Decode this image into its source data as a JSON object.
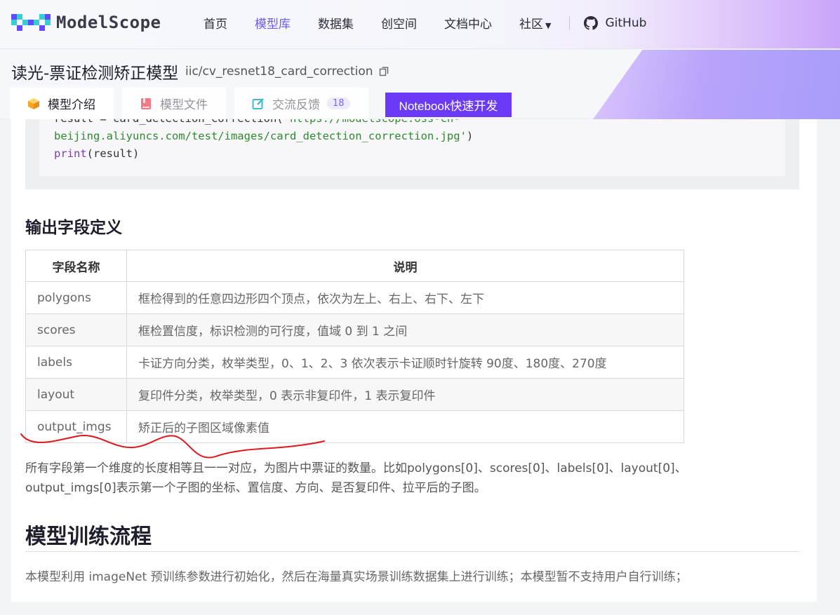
{
  "nav": {
    "logo_text": "ModelScope",
    "links": [
      {
        "label": "首页",
        "active": false
      },
      {
        "label": "模型库",
        "active": true
      },
      {
        "label": "数据集",
        "active": false
      },
      {
        "label": "创空间",
        "active": false
      },
      {
        "label": "文档中心",
        "active": false
      },
      {
        "label": "社区",
        "active": false
      }
    ],
    "github_label": "GitHub"
  },
  "model": {
    "title": "读光-票证检测矫正模型",
    "path": "iic/cv_resnet18_card_correction",
    "tabs": [
      {
        "label": "模型介绍",
        "icon": "box-icon"
      },
      {
        "label": "模型文件",
        "icon": "book-icon"
      },
      {
        "label": "交流反馈",
        "icon": "edit-icon",
        "count": "18"
      }
    ],
    "notebook_label": "Notebook快速开发"
  },
  "code": {
    "line1_a": "result = card_detection_correction(",
    "line1_b": "'https://modelscope.oss-cn-",
    "line2_a": "beijing.aliyuncs.com/test/images/card_detection_correction.jpg'",
    "line2_b": ")",
    "line3_fn": "print",
    "line3_rest": "(result)"
  },
  "output_section": {
    "title": "输出字段定义",
    "headers": [
      "字段名称",
      "说明"
    ],
    "rows": [
      [
        "polygons",
        "框检得到的任意四边形四个顶点，依次为左上、右上、右下、左下"
      ],
      [
        "scores",
        "框检置信度，标识检测的可行度，值域 0 到 1 之间"
      ],
      [
        "labels",
        "卡证方向分类，枚举类型，0、1、2、3 依次表示卡证顺时针旋转 90度、180度、270度"
      ],
      [
        "layout",
        "复印件分类，枚举类型，0 表示非复印件，1 表示复印件"
      ],
      [
        "output_imgs",
        "矫正后的子图区域像素值"
      ]
    ],
    "note_line1": "所有字段第一个维度的长度相等且一一对应，为图片中票证的数量。比如polygons[0]、scores[0]、labels[0]、layout[0]、",
    "note_line2": "output_imgs[0]表示第一个子图的坐标、置信度、方向、是否复印件、拉平后的子图。"
  },
  "training_section": {
    "title": "模型训练流程",
    "text": "本模型利用 imageNet 预训练参数进行初始化，然后在海量真实场景训练数据集上进行训练；本模型暂不支持用户自行训练；"
  },
  "colors": {
    "accent": "#6a5cf0",
    "button": "#6a3af6",
    "annotation": "#e0161c"
  }
}
